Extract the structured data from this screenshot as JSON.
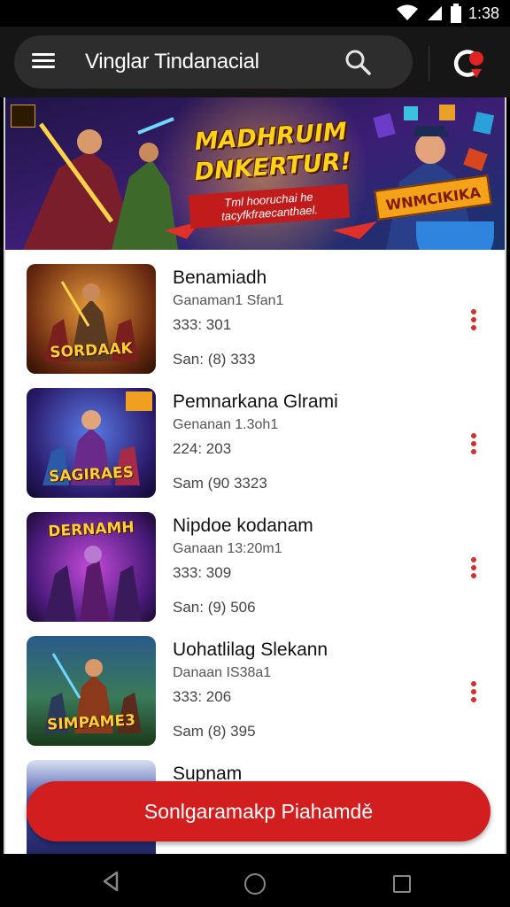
{
  "status_bar": {
    "time": "1:38"
  },
  "app_bar": {
    "title": "Vinglar Tindanacial",
    "menu_icon": "menu-icon",
    "search_icon": "search-icon",
    "brand_icon": "brand-logo-icon"
  },
  "banner": {
    "title": "MADHRUIM DNKERTUR!",
    "tagline": "Tml hooruchai he tacyfkfraecanthael.",
    "badge": "WNMCIKIKA"
  },
  "games": [
    {
      "title": "Benamiadh",
      "subtitle": "Ganaman1 Sfan1",
      "number": "333: 301",
      "size": "San: (8) 333",
      "thumb_label": "SORDAAK"
    },
    {
      "title": "Pemnarkana Glrami",
      "subtitle": "Genanan 1.3oh1",
      "number": "224: 203",
      "size": "Sam (90 3323",
      "thumb_label": "SAGIRAES"
    },
    {
      "title": "Nipdoe kodanam",
      "subtitle": "Ganaan 13:20m1",
      "number": "333: 309",
      "size": "San: (9) 506",
      "thumb_label": "DERNAMH"
    },
    {
      "title": "Uohatlilag Slekann",
      "subtitle": "Danaan IS38a1",
      "number": "333: 206",
      "size": "Sam (8) 395",
      "thumb_label": "SIMPAME3"
    },
    {
      "title": "Supnam",
      "subtitle": "",
      "number": "",
      "size": "",
      "thumb_label": ""
    }
  ],
  "cta": {
    "label": "Sonlgaramakp Piahamdě"
  },
  "colors": {
    "accent": "#d21e1e",
    "app_bar": "#161616",
    "pill": "#2d2d2d",
    "more_dots": "#d32f2f",
    "banner_title": "#ffd21a"
  }
}
